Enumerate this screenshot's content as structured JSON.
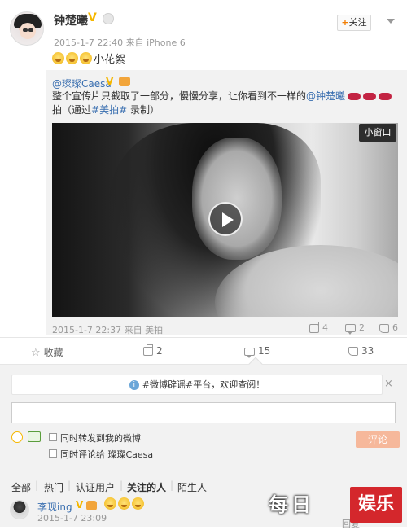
{
  "post": {
    "author": "钟楚曦",
    "verified_mark": "V",
    "follow_label": "关注",
    "follow_plus": "+",
    "meta": "2015-1-7 22:40 来自 iPhone 6",
    "text": "小花絮",
    "emoji_count": 3
  },
  "quoted": {
    "author": "@璨璨Caesa",
    "verified_mark": "V",
    "text_part1": "整个宣传片只截取了一部分，慢慢分享，让你看到不一样的",
    "mention": "@钟楚曦",
    "text_part2": "拍（通过",
    "topic": "#美拍#",
    "text_part3": " 录制）",
    "pip_label": "小窗口",
    "meta": "2015-1-7 22:37 来自 美拍",
    "forward_count": "4",
    "comment_count": "2",
    "like_count": "6"
  },
  "actions": {
    "favorite_label": "收藏",
    "forward_count": "2",
    "comment_count": "15",
    "like_count": "33"
  },
  "comment_box": {
    "notice": "#微博辟谣#平台，欢迎查阅！",
    "notice_info": "i",
    "close_label": "×",
    "input_value": "",
    "option1": "同时转发到我的微博",
    "option2": "同时评论给 璨璨Caesa",
    "submit_label": "评论"
  },
  "filters": {
    "items": [
      "全部",
      "热门",
      "认证用户",
      "关注的人",
      "陌生人"
    ],
    "active": "关注的人"
  },
  "comment": {
    "user": "李现ing",
    "verified_mark": "V",
    "time": "2015-1-7 23:09",
    "reply_hint": "回复"
  },
  "watermark": {
    "left_text": "每日",
    "right_text": "娱乐"
  }
}
